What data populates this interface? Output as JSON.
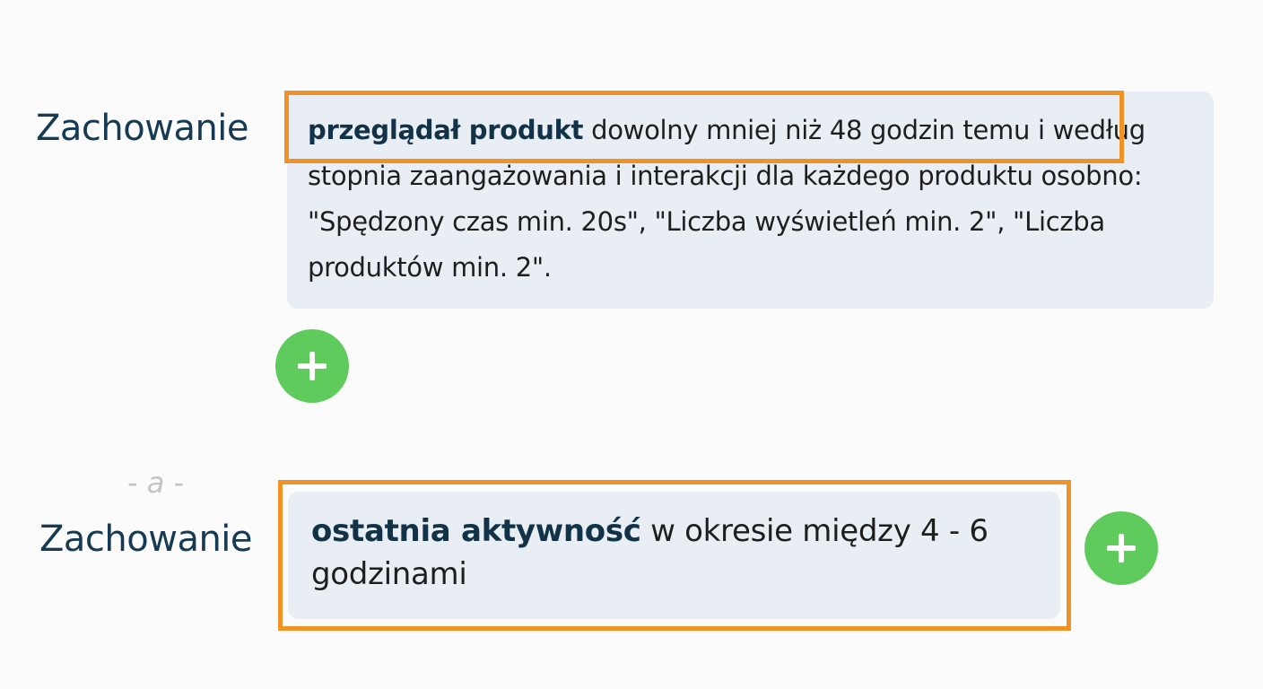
{
  "conditions": [
    {
      "label": "Zachowanie",
      "keyword": "przeglądał produkt",
      "line1_rest": " dowolny mniej niż 48 godzin temu i",
      "rest": " według stopnia zaangażowania i interakcji dla każdego produktu osobno: \"Spędzony czas min. 20s\", \"Liczba wyświetleń min. 2\", \"Liczba produktów min. 2\"."
    },
    {
      "label": "Zachowanie",
      "keyword": "ostatnia aktywność",
      "rest": " w okresie między 4 - 6 godzinami"
    }
  ],
  "connector": "- a -",
  "icons": {
    "add": "plus-icon"
  },
  "colors": {
    "highlight": "#ef9326",
    "add_button": "#5ecb5c",
    "condition_background": "#e8eef3",
    "label_text": "#163a52"
  }
}
